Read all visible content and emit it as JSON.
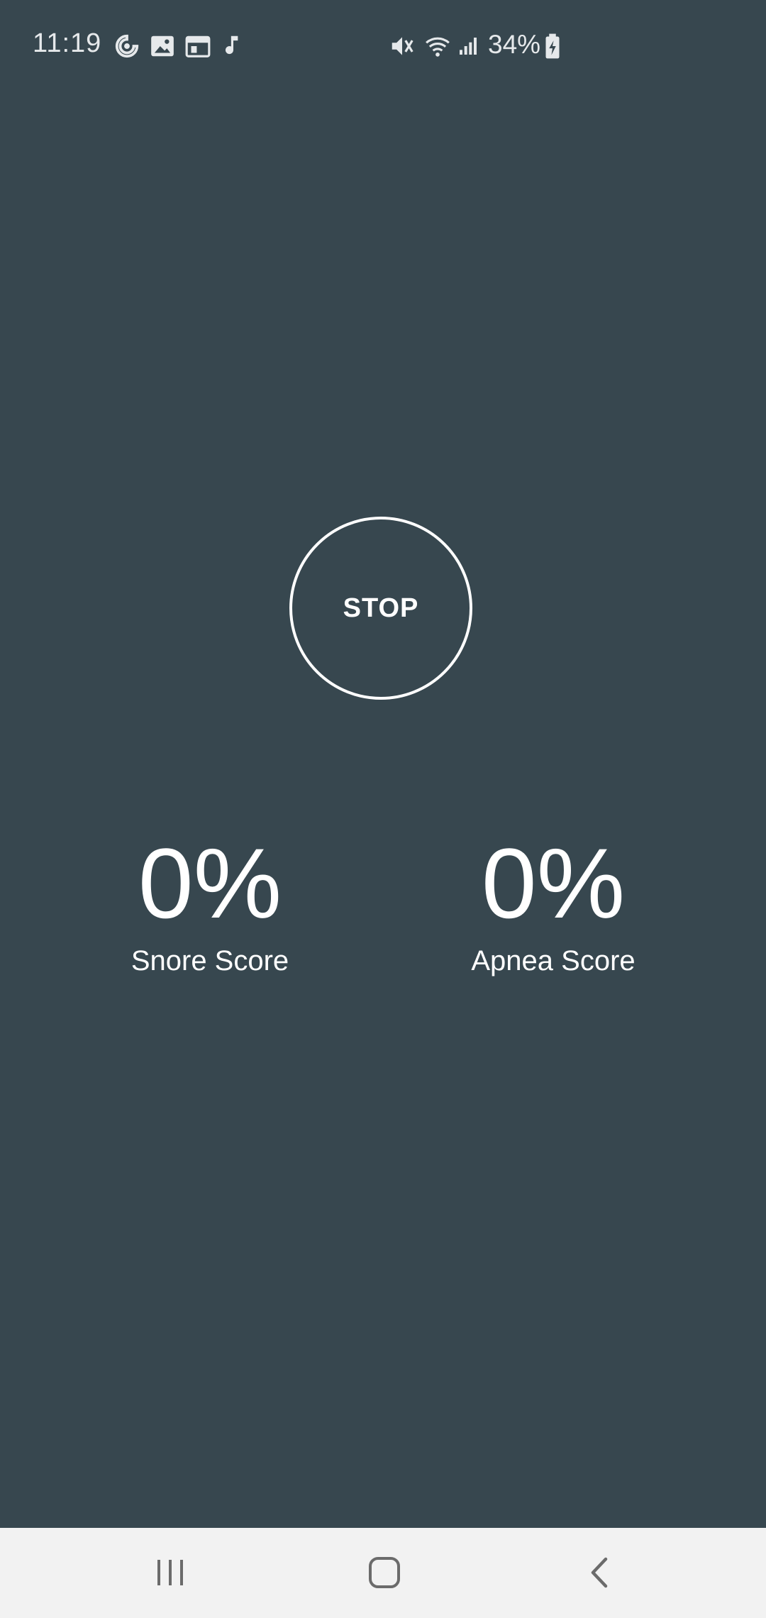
{
  "status_bar": {
    "time": "11:19",
    "battery": "34%",
    "icons": [
      "sync-icon",
      "image-icon",
      "calendar-icon",
      "music-note-icon",
      "mute-icon",
      "wifi-icon",
      "signal-icon",
      "battery-charging-icon"
    ]
  },
  "main": {
    "stop_label": "STOP",
    "snore": {
      "value": "0%",
      "label": "Snore Score"
    },
    "apnea": {
      "value": "0%",
      "label": "Apnea Score"
    }
  },
  "nav_bar": {
    "buttons": [
      "recent-apps-button",
      "home-button",
      "back-button"
    ]
  },
  "colors": {
    "background": "#37474f",
    "nav_background": "#f2f2f2",
    "text": "#ffffff"
  }
}
